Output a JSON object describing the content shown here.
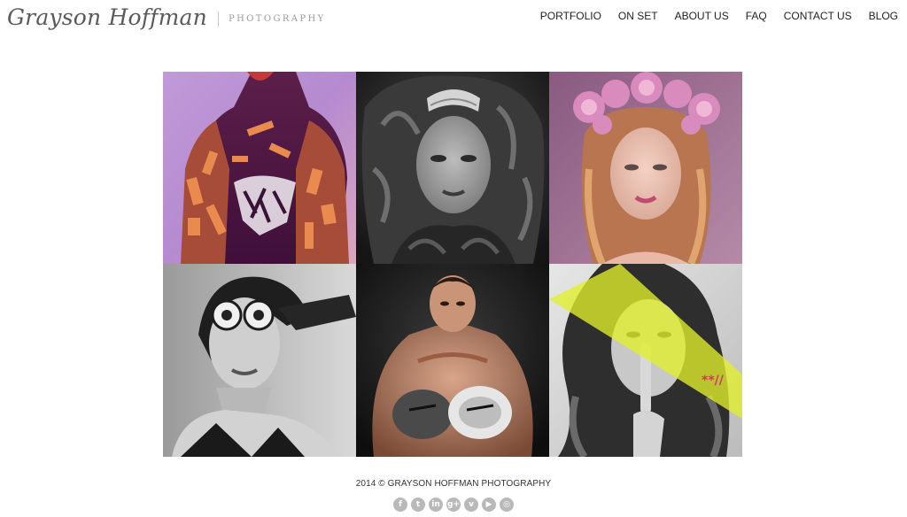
{
  "brand": {
    "name": "Grayson Hoffman",
    "tagline": "PHOTOGRAPHY"
  },
  "nav": {
    "items": [
      {
        "label": "PORTFOLIO"
      },
      {
        "label": "ON SET"
      },
      {
        "label": "ABOUT US"
      },
      {
        "label": "FAQ"
      },
      {
        "label": "CONTACT US"
      },
      {
        "label": "BLOG"
      }
    ]
  },
  "gallery": {
    "tiles": [
      {
        "subject": "model with orange tribal body paint"
      },
      {
        "subject": "black and white portrait with headpiece"
      },
      {
        "subject": "woman with pink flower crown"
      },
      {
        "subject": "black and white portrait with sunglasses"
      },
      {
        "subject": "boxer with gloves"
      },
      {
        "subject": "woman shushing with yellow graphic band",
        "overlay_text": "**//"
      }
    ]
  },
  "footer": {
    "copyright": "2014 © GRAYSON HOFFMAN PHOTOGRAPHY",
    "social": [
      {
        "icon": "facebook-icon",
        "glyph": "f"
      },
      {
        "icon": "twitter-icon",
        "glyph": "t"
      },
      {
        "icon": "linkedin-icon",
        "glyph": "in"
      },
      {
        "icon": "google-plus-icon",
        "glyph": "g+"
      },
      {
        "icon": "vimeo-icon",
        "glyph": "v"
      },
      {
        "icon": "youtube-icon",
        "glyph": "▶"
      },
      {
        "icon": "instagram-icon",
        "glyph": "◎"
      }
    ]
  },
  "colors": {
    "accent_yellow": "#e2ef2c",
    "accent_magenta": "#d6336f",
    "text": "#222222"
  }
}
